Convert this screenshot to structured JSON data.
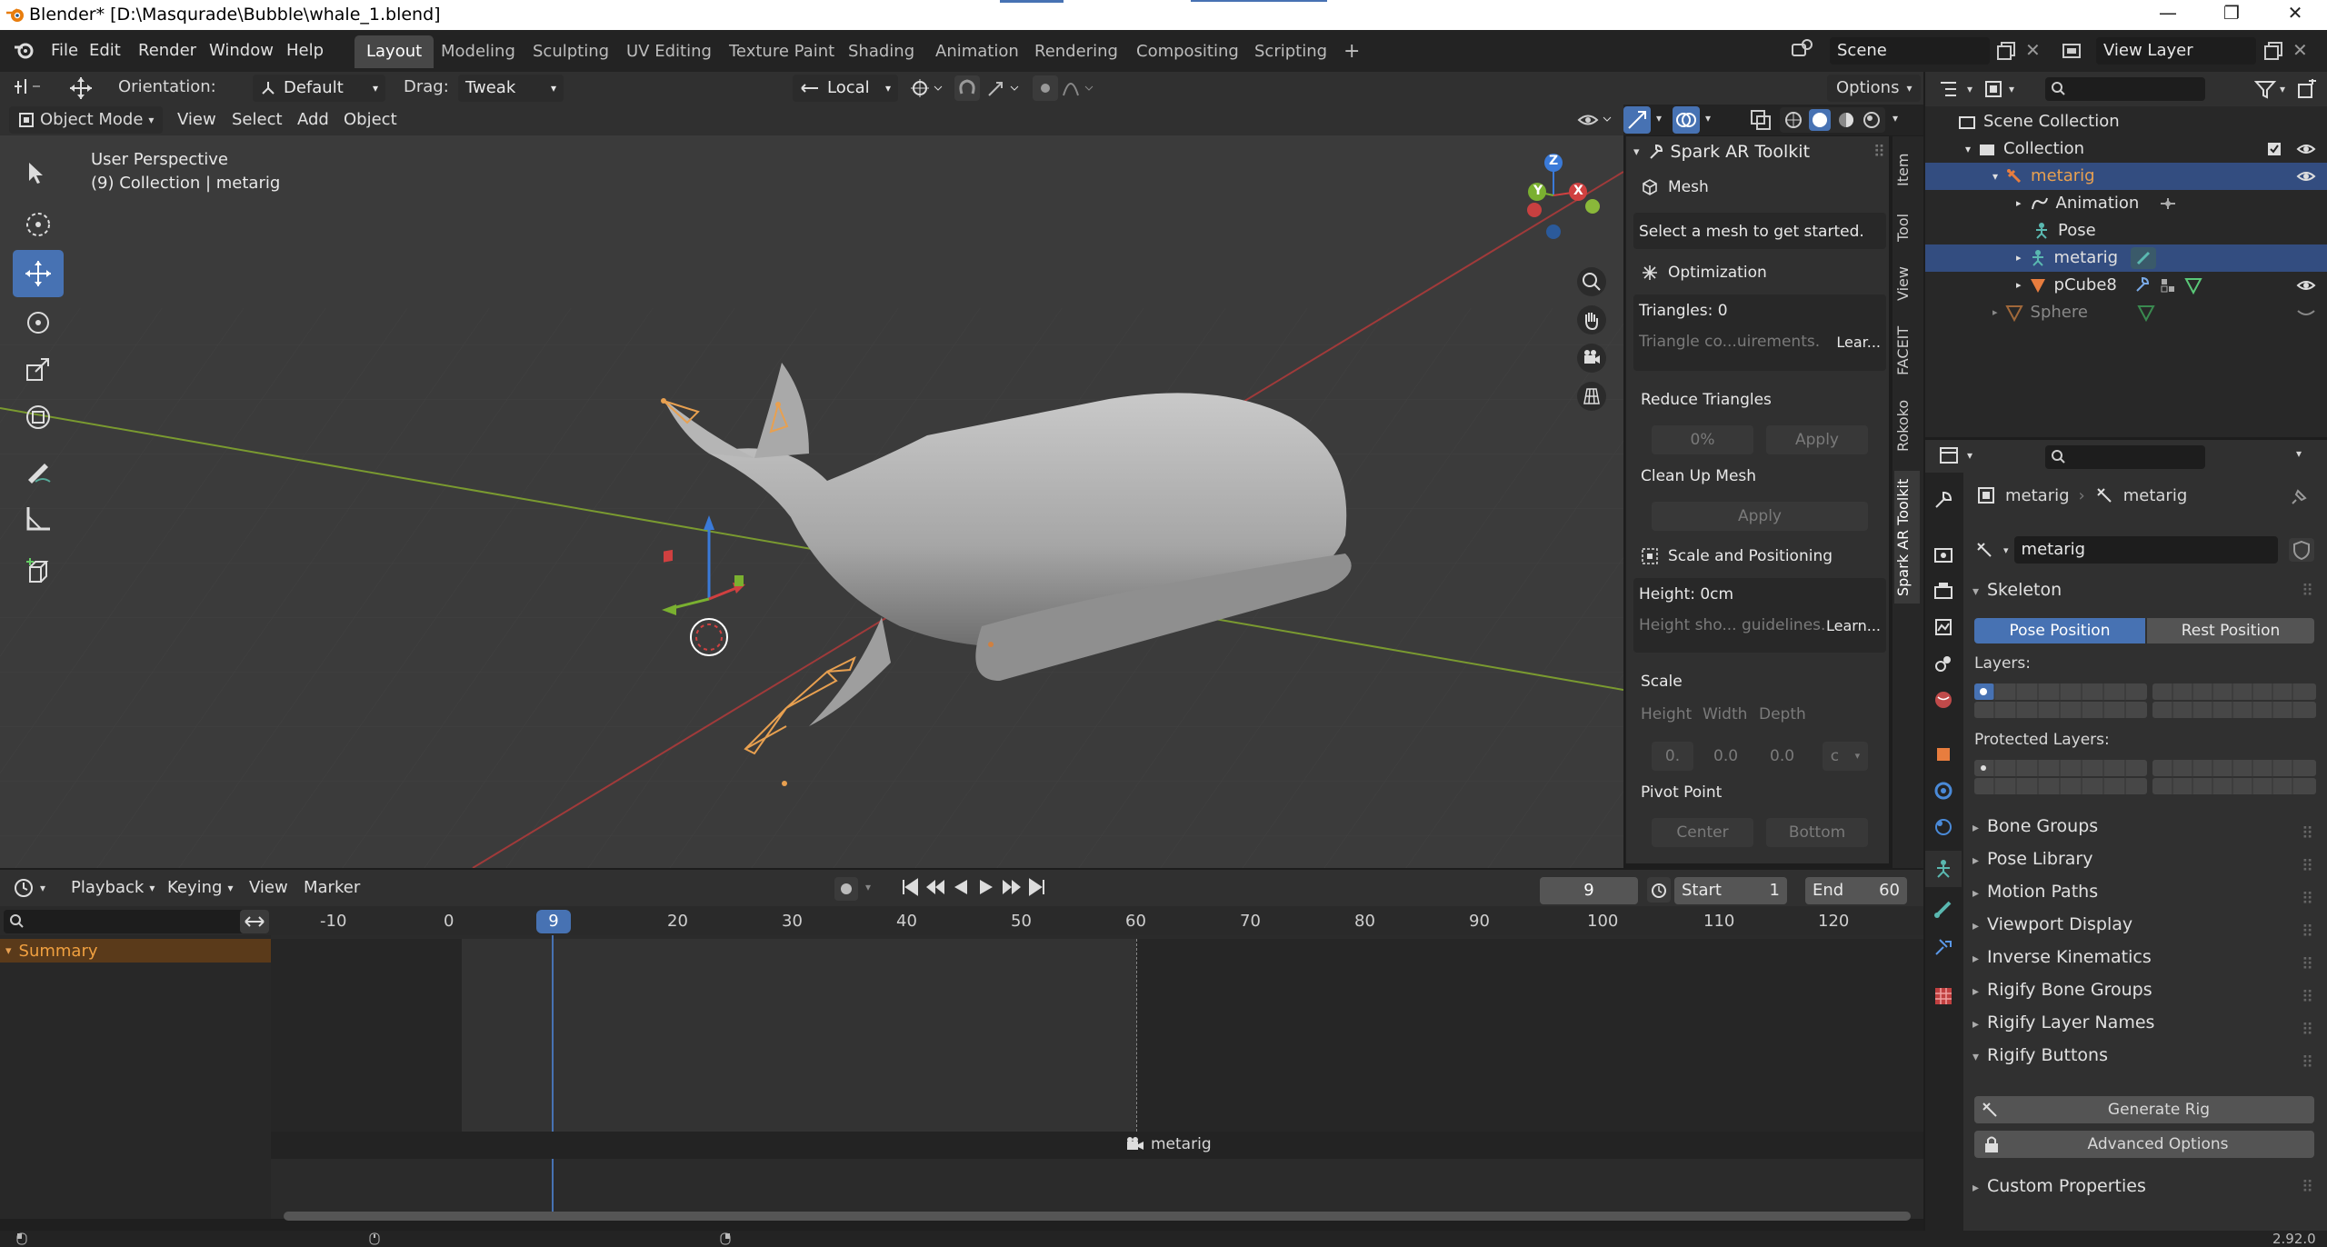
{
  "window": {
    "title": "Blender* [D:\\Masqurade\\Bubble\\whale_1.blend]",
    "minimize": "—",
    "maximize": "❐",
    "close": "✕"
  },
  "menus": [
    "File",
    "Edit",
    "Render",
    "Window",
    "Help"
  ],
  "workspaces": [
    "Layout",
    "Modeling",
    "Sculpting",
    "UV Editing",
    "Texture Paint",
    "Shading",
    "Animation",
    "Rendering",
    "Compositing",
    "Scripting"
  ],
  "topbar": {
    "add_tab": "+",
    "scene": "Scene",
    "view_layer": "View Layer"
  },
  "toolsettings": {
    "orientation_label": "Orientation:",
    "orientation": "Default",
    "drag_label": "Drag:",
    "drag": "Tweak",
    "pivot": "Local",
    "options": "Options"
  },
  "viewport": {
    "mode": "Object Mode",
    "menus": [
      "View",
      "Select",
      "Add",
      "Object"
    ],
    "perspective": "User Perspective",
    "collection_info": "(9) Collection | metarig",
    "gizmo": {
      "x": "X",
      "y": "Y",
      "z": "Z"
    }
  },
  "npanel": {
    "title": "Spark AR Toolkit",
    "mesh_label": "Mesh",
    "mesh_msg": "Select a mesh to get started.",
    "opt_label": "Optimization",
    "triangles": "Triangles: 0",
    "tri_note": "Triangle co...uirements.",
    "learn1": "Lear...",
    "reduce_label": "Reduce Triangles",
    "reduce_val": "0%",
    "apply1": "Apply",
    "clean_label": "Clean Up Mesh",
    "apply2": "Apply",
    "scale_pos_label": "Scale and Positioning",
    "height": "Height: 0cm",
    "height_note": "Height sho... guidelines.",
    "learn2": "Learn...",
    "scale_label": "Scale",
    "h_lbl": "Height",
    "w_lbl": "Width",
    "d_lbl": "Depth",
    "h_val": "0.",
    "w_val": "0.0",
    "d_val": "0.0",
    "unit": "c",
    "pivot_label": "Pivot Point",
    "center": "Center",
    "bottom": "Bottom",
    "tabs": [
      "Item",
      "Tool",
      "View",
      "FACEIT",
      "Rokoko",
      "Spark AR Toolkit"
    ]
  },
  "timeline": {
    "menus": [
      "Playback",
      "Keying",
      "View",
      "Marker"
    ],
    "current_frame": "9",
    "start_label": "Start",
    "start": "1",
    "end_label": "End",
    "end": "60",
    "ticks": [
      "-10",
      "0",
      "9",
      "20",
      "30",
      "40",
      "50",
      "60",
      "70",
      "80",
      "90",
      "100",
      "110",
      "120"
    ],
    "summary": "Summary",
    "marker": "metarig"
  },
  "outliner": {
    "rows": [
      {
        "label": "Scene Collection"
      },
      {
        "label": "Collection"
      },
      {
        "label": "metarig"
      },
      {
        "label": "Animation"
      },
      {
        "label": "Pose"
      },
      {
        "label": "metarig"
      },
      {
        "label": "pCube8"
      },
      {
        "label": "Sphere"
      }
    ]
  },
  "properties": {
    "crumb1": "metarig",
    "crumb2": "metarig",
    "name": "metarig",
    "skeleton": "Skeleton",
    "pose_position": "Pose Position",
    "rest_position": "Rest Position",
    "layers": "Layers:",
    "protected_layers": "Protected Layers:",
    "panels": [
      "Bone Groups",
      "Pose Library",
      "Motion Paths",
      "Viewport Display",
      "Inverse Kinematics",
      "Rigify Bone Groups",
      "Rigify Layer Names"
    ],
    "rigify_buttons": "Rigify Buttons",
    "generate_rig": "Generate Rig",
    "advanced_options": "Advanced Options",
    "custom_properties": "Custom Properties"
  },
  "status": {
    "version": "2.92.0"
  },
  "colors": {
    "accent": "#4772b3",
    "active_bg": "#334d80",
    "bone": "#e8a050",
    "object_orange": "#e87d3e"
  }
}
